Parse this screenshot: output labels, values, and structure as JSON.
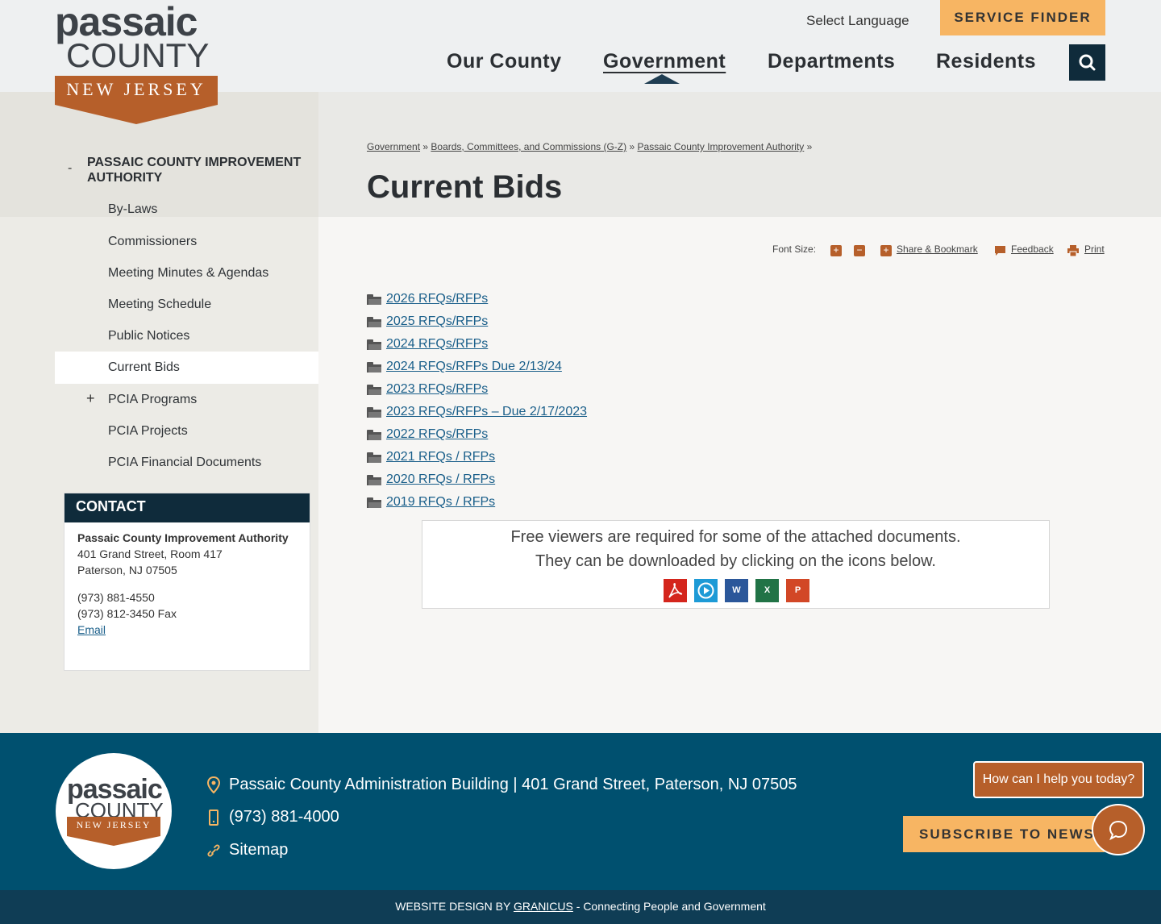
{
  "logo": {
    "line1": "passaic",
    "line2": "COUNTY",
    "line3": "NEW JERSEY",
    "brand_color": "#b65f2a"
  },
  "header": {
    "select_language": "Select Language",
    "service_finder": "SERVICE FINDER",
    "nav": [
      "Our County",
      "Government",
      "Departments",
      "Residents"
    ],
    "active_nav": "Government"
  },
  "sidebar": {
    "title": "PASSAIC COUNTY IMPROVEMENT AUTHORITY",
    "collapse_symbol": "-",
    "expand_symbol": "+",
    "items": [
      "By-Laws",
      "Commissioners",
      "Meeting Minutes & Agendas",
      "Meeting Schedule",
      "Public Notices",
      "Current Bids",
      "PCIA Programs",
      "PCIA Projects",
      "PCIA Financial Documents"
    ],
    "active_item": "Current Bids"
  },
  "contact": {
    "heading": "CONTACT",
    "org": "Passaic County Improvement Authority",
    "address1": "401 Grand Street, Room 417",
    "address2": "Paterson, NJ 07505",
    "phone": "(973) 881-4550",
    "fax": "(973) 812-3450 Fax",
    "email_label": "Email"
  },
  "breadcrumb": {
    "items": [
      "Government",
      "Boards, Committees, and Commissions (G-Z)",
      "Passaic County Improvement Authority"
    ],
    "separator": "»"
  },
  "page_title": "Current Bids",
  "tools": {
    "font_size_label": "Font Size:",
    "increase": "+",
    "decrease": "−",
    "share": "Share & Bookmark",
    "feedback": "Feedback",
    "print": "Print"
  },
  "bids": [
    "2026 RFQs/RFPs",
    "2025 RFQs/RFPs",
    "2024 RFQs/RFPs",
    "2024 RFQs/RFPs Due 2/13/24",
    "2023 RFQs/RFPs",
    "2023 RFQs/RFPs – Due 2/17/2023",
    "2022 RFQs/RFPs",
    "2021 RFQs / RFPs",
    "2020 RFQs / RFPs",
    "2019 RFQs / RFPs"
  ],
  "viewers": {
    "line1": "Free viewers are required for some of the attached documents.",
    "line2": "They can be downloaded by clicking on the icons below.",
    "icons": [
      {
        "name": "pdf-icon",
        "color": "#d4251c"
      },
      {
        "name": "media-player-icon",
        "color": "#1d9ad6"
      },
      {
        "name": "word-icon",
        "color": "#2b579a"
      },
      {
        "name": "excel-icon",
        "color": "#217346"
      },
      {
        "name": "powerpoint-icon",
        "color": "#d24726"
      }
    ]
  },
  "footer": {
    "address": "Passaic County Administration Building | 401 Grand Street, Paterson, NJ 07505",
    "phone": "(973) 881-4000",
    "sitemap": "Sitemap",
    "chat_prompt": "How can I help you today?",
    "subscribe": "SUBSCRIBE TO NEWS",
    "credit_prefix": "WEBSITE DESIGN BY",
    "credit_link": "GRANICUS",
    "credit_suffix": "- Connecting People and Government"
  }
}
